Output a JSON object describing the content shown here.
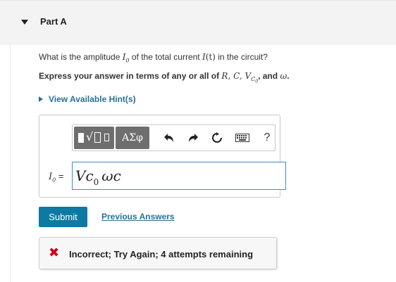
{
  "part": {
    "title": "Part A"
  },
  "question": {
    "prefix": "What is the amplitude ",
    "symbol_main": "I",
    "symbol_sub": "0",
    "middle": " of the total current ",
    "func": "I",
    "func_arg": "(t)",
    "suffix": " in the circuit?"
  },
  "instruction": {
    "prefix": "Express your answer in terms of any or all of ",
    "vars": "R, C, V",
    "vc_sub": "C",
    "vc_subsub": "0",
    "and": ", and ",
    "omega": "ω",
    "end": "."
  },
  "hint": {
    "label": "View Available Hint(s)"
  },
  "toolbar": {
    "template_icon": "templates-icon",
    "greek_label": "ΑΣφ",
    "undo_icon": "undo-icon",
    "redo_icon": "redo-icon",
    "reset_icon": "reset-icon",
    "keyboard_icon": "keyboard-icon",
    "help_label": "?"
  },
  "answer": {
    "label_symbol": "I",
    "label_sub": "0",
    "label_eq": " =",
    "value_v": "Vc",
    "value_sub": "0",
    "value_rest": "ωc"
  },
  "actions": {
    "submit_label": "Submit",
    "previous_label": "Previous Answers"
  },
  "feedback": {
    "icon": "incorrect-x-icon",
    "text": "Incorrect; Try Again; 4 attempts remaining",
    "color": "#d0021b"
  },
  "colors": {
    "link": "#2a6f97",
    "submit_bg": "#0c7aa3",
    "header_bg": "#f3f3f3"
  }
}
